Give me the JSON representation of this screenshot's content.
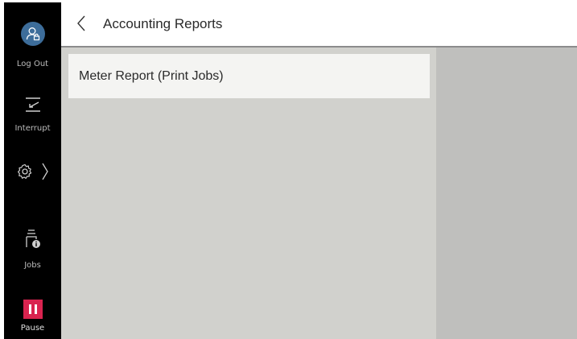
{
  "sidebar": {
    "logout_label": "Log Out",
    "interrupt_label": "Interrupt",
    "jobs_label": "Jobs",
    "pause_label": "Pause",
    "icons": {
      "logout": "user-icon",
      "interrupt": "interrupt-icon",
      "settings": "gear-icon",
      "settings_expand": "chevron-right-icon",
      "jobs": "jobs-info-icon",
      "pause": "pause-icon"
    }
  },
  "header": {
    "title": "Accounting Reports",
    "back_icon": "chevron-left-icon"
  },
  "main": {
    "items": [
      {
        "label": "Meter Report (Print Jobs)"
      }
    ]
  },
  "colors": {
    "sidebar_bg": "#000000",
    "avatar_bg": "#3d6d9a",
    "pause_bg": "#d9234f",
    "content_bg": "#d1d1cd",
    "right_panel_bg": "#bfbfbd",
    "item_bg": "#f4f4f2"
  }
}
